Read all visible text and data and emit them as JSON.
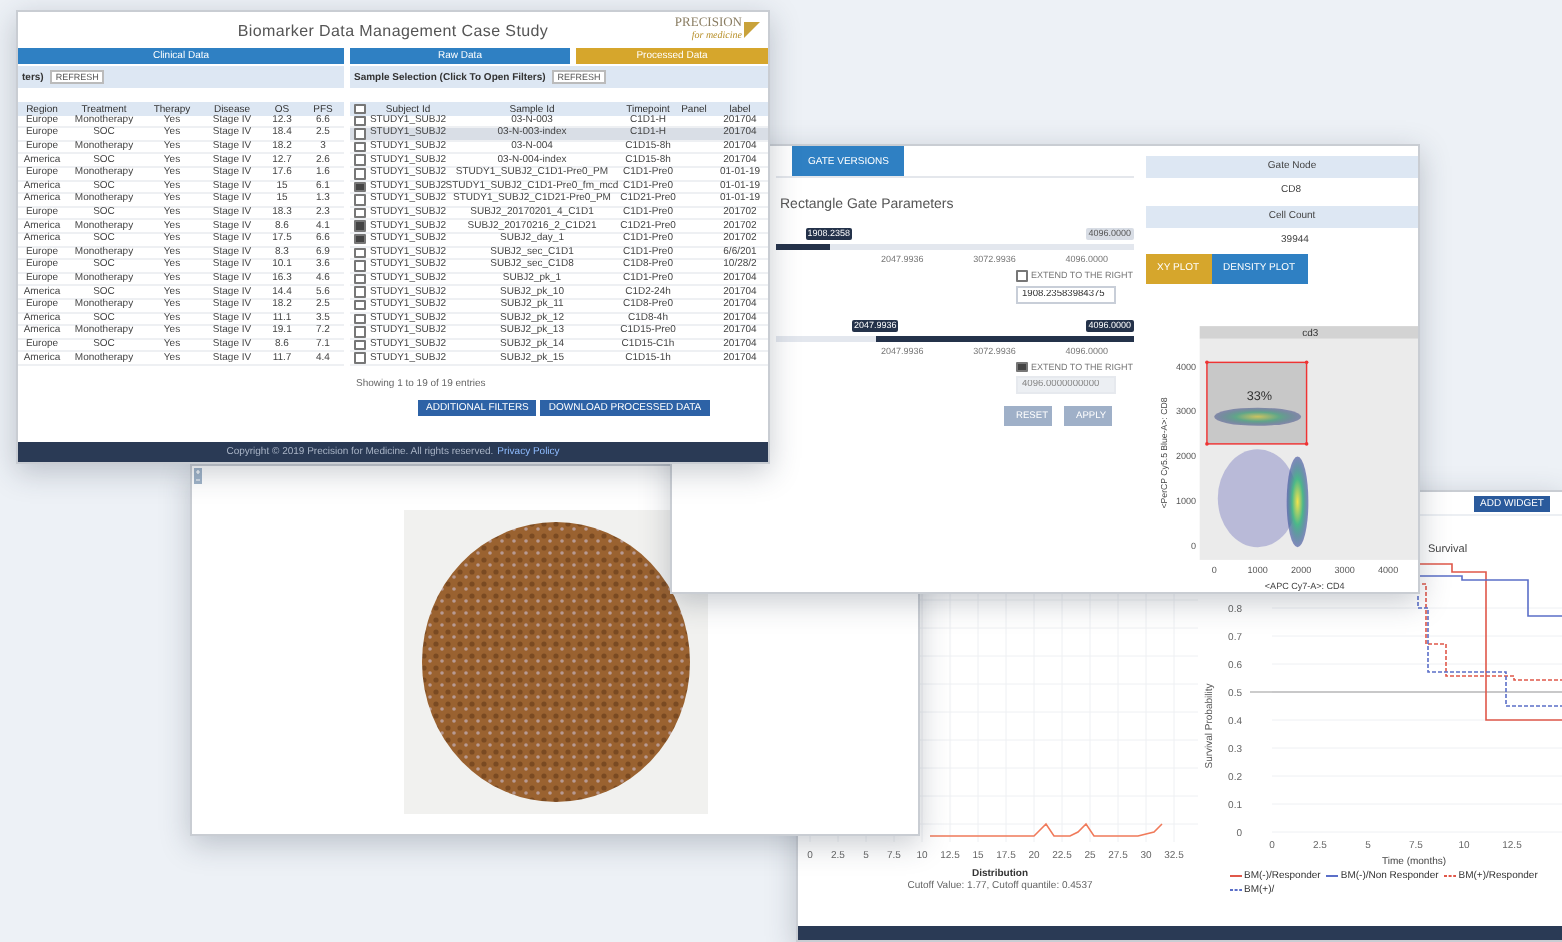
{
  "table_window": {
    "title": "Biomarker Data Management Case Study",
    "logo": {
      "name": "PRECISION",
      "tagline": "for medicine"
    },
    "tabs": [
      {
        "label": "Clinical Data",
        "selected": false
      },
      {
        "label": "Raw Data",
        "selected": false
      },
      {
        "label": "Processed Data",
        "selected": true
      }
    ],
    "filters": [
      {
        "label": "ters)",
        "button": "REFRESH"
      },
      {
        "label": "Sample Selection (Click To Open Filters)",
        "button": "REFRESH"
      }
    ],
    "clinical_table": {
      "columns": [
        "Region",
        "Treatment",
        "Therapy",
        "Disease",
        "OS",
        "PFS"
      ],
      "rows": [
        [
          "Europe",
          "Monotherapy",
          "Yes",
          "Stage IV",
          "12.3",
          "6.6"
        ],
        [
          "Europe",
          "SOC",
          "Yes",
          "Stage IV",
          "18.4",
          "2.5"
        ],
        [
          "Europe",
          "Monotherapy",
          "Yes",
          "Stage IV",
          "18.2",
          "3"
        ],
        [
          "America",
          "SOC",
          "Yes",
          "Stage IV",
          "12.7",
          "2.6"
        ],
        [
          "Europe",
          "Monotherapy",
          "Yes",
          "Stage IV",
          "17.6",
          "1.6"
        ],
        [
          "America",
          "SOC",
          "Yes",
          "Stage IV",
          "15",
          "6.1"
        ],
        [
          "America",
          "Monotherapy",
          "Yes",
          "Stage IV",
          "15",
          "1.3"
        ],
        [
          "Europe",
          "SOC",
          "Yes",
          "Stage IV",
          "18.3",
          "2.3"
        ],
        [
          "America",
          "Monotherapy",
          "Yes",
          "Stage IV",
          "8.6",
          "4.1"
        ],
        [
          "America",
          "SOC",
          "Yes",
          "Stage IV",
          "17.5",
          "6.6"
        ],
        [
          "Europe",
          "Monotherapy",
          "Yes",
          "Stage IV",
          "8.3",
          "6.9"
        ],
        [
          "Europe",
          "SOC",
          "Yes",
          "Stage IV",
          "10.1",
          "3.6"
        ],
        [
          "Europe",
          "Monotherapy",
          "Yes",
          "Stage IV",
          "16.3",
          "4.6"
        ],
        [
          "America",
          "SOC",
          "Yes",
          "Stage IV",
          "14.4",
          "5.6"
        ],
        [
          "Europe",
          "Monotherapy",
          "Yes",
          "Stage IV",
          "18.2",
          "2.5"
        ],
        [
          "America",
          "SOC",
          "Yes",
          "Stage IV",
          "11.1",
          "3.5"
        ],
        [
          "America",
          "Monotherapy",
          "Yes",
          "Stage IV",
          "19.1",
          "7.2"
        ],
        [
          "Europe",
          "SOC",
          "Yes",
          "Stage IV",
          "8.6",
          "7.1"
        ],
        [
          "America",
          "Monotherapy",
          "Yes",
          "Stage IV",
          "11.7",
          "4.4"
        ]
      ]
    },
    "sample_table": {
      "header_checked": false,
      "columns": [
        "Subject Id",
        "Sample Id",
        "Timepoint",
        "Panel",
        "label"
      ],
      "rows": [
        {
          "checked": false,
          "selected": false,
          "cells": [
            "STUDY1_SUBJ2",
            "03-N-003",
            "C1D1-H",
            "",
            "201704"
          ]
        },
        {
          "checked": false,
          "selected": true,
          "cells": [
            "STUDY1_SUBJ2",
            "03-N-003-index",
            "C1D1-H",
            "",
            "201704"
          ]
        },
        {
          "checked": false,
          "selected": false,
          "cells": [
            "STUDY1_SUBJ2",
            "03-N-004",
            "C1D15-8h",
            "",
            "201704"
          ]
        },
        {
          "checked": false,
          "selected": false,
          "cells": [
            "STUDY1_SUBJ2",
            "03-N-004-index",
            "C1D15-8h",
            "",
            "201704"
          ]
        },
        {
          "checked": false,
          "selected": false,
          "cells": [
            "STUDY1_SUBJ2",
            "STUDY1_SUBJ2_C1D1-Pre0_PM",
            "C1D1-Pre0",
            "",
            "01-01-19"
          ]
        },
        {
          "checked": true,
          "selected": false,
          "cells": [
            "STUDY1_SUBJ2",
            "STUDY1_SUBJ2_C1D1-Pre0_fm_mcd",
            "C1D1-Pre0",
            "",
            "01-01-19"
          ]
        },
        {
          "checked": false,
          "selected": false,
          "cells": [
            "STUDY1_SUBJ2",
            "STUDY1_SUBJ2_C1D21-Pre0_PM",
            "C1D21-Pre0",
            "",
            "01-01-19"
          ]
        },
        {
          "checked": false,
          "selected": false,
          "cells": [
            "STUDY1_SUBJ2",
            "SUBJ2_20170201_4_C1D1",
            "C1D1-Pre0",
            "",
            "201702"
          ]
        },
        {
          "checked": true,
          "selected": false,
          "cells": [
            "STUDY1_SUBJ2",
            "SUBJ2_20170216_2_C1D21",
            "C1D21-Pre0",
            "",
            "201702"
          ]
        },
        {
          "checked": true,
          "selected": false,
          "cells": [
            "STUDY1_SUBJ2",
            "SUBJ2_day_1",
            "C1D1-Pre0",
            "",
            "201702"
          ]
        },
        {
          "checked": false,
          "selected": false,
          "cells": [
            "STUDY1_SUBJ2",
            "SUBJ2_sec_C1D1",
            "C1D1-Pre0",
            "",
            "6/6/201"
          ]
        },
        {
          "checked": false,
          "selected": false,
          "cells": [
            "STUDY1_SUBJ2",
            "SUBJ2_sec_C1D8",
            "C1D8-Pre0",
            "",
            "10/28/2"
          ]
        },
        {
          "checked": false,
          "selected": false,
          "cells": [
            "STUDY1_SUBJ2",
            "SUBJ2_pk_1",
            "C1D1-Pre0",
            "",
            "201704"
          ]
        },
        {
          "checked": false,
          "selected": false,
          "cells": [
            "STUDY1_SUBJ2",
            "SUBJ2_pk_10",
            "C1D2-24h",
            "",
            "201704"
          ]
        },
        {
          "checked": false,
          "selected": false,
          "cells": [
            "STUDY1_SUBJ2",
            "SUBJ2_pk_11",
            "C1D8-Pre0",
            "",
            "201704"
          ]
        },
        {
          "checked": false,
          "selected": false,
          "cells": [
            "STUDY1_SUBJ2",
            "SUBJ2_pk_12",
            "C1D8-4h",
            "",
            "201704"
          ]
        },
        {
          "checked": false,
          "selected": false,
          "cells": [
            "STUDY1_SUBJ2",
            "SUBJ2_pk_13",
            "C1D15-Pre0",
            "",
            "201704"
          ]
        },
        {
          "checked": false,
          "selected": false,
          "cells": [
            "STUDY1_SUBJ2",
            "SUBJ2_pk_14",
            "C1D15-C1h",
            "",
            "201704"
          ]
        },
        {
          "checked": false,
          "selected": false,
          "cells": [
            "STUDY1_SUBJ2",
            "SUBJ2_pk_15",
            "C1D15-1h",
            "",
            "201704"
          ]
        }
      ]
    },
    "entries_info": "Showing 1 to 19 of 19 entries",
    "buttons": [
      "ADDITIONAL FILTERS",
      "DOWNLOAD PROCESSED DATA"
    ],
    "footer": {
      "text": "Copyright © 2019 Precision for Medicine. All rights reserved.",
      "link": "Privacy Policy"
    }
  },
  "gate_window": {
    "tabs": [
      {
        "label": "GATE VERSIONS",
        "selected": true
      }
    ],
    "heading": "Rectangle Gate Parameters",
    "sliders": [
      {
        "kind": "lower",
        "level": 0.15,
        "thumb_label": "1908.2358",
        "max_label": "4096.0000",
        "ticks": [
          "2047.9936",
          "3072.9936",
          "4096.0000"
        ],
        "extend": {
          "label": "EXTEND TO THE RIGHT",
          "checked": false
        },
        "field": {
          "value": "1908.23583984375",
          "disabled": false
        }
      },
      {
        "kind": "upper",
        "level": 0.72,
        "thumb_label": "2047.9936",
        "max_label": "4096.0000",
        "ticks": [
          "2047.9936",
          "3072.9936",
          "4096.0000"
        ],
        "extend": {
          "label": "EXTEND TO THE RIGHT",
          "checked": true
        },
        "field": {
          "placeholder": "4096.0000000000",
          "disabled": true
        }
      }
    ],
    "buttons": [
      {
        "label": "RESET",
        "disabled": true
      },
      {
        "label": "APPLY",
        "disabled": true
      }
    ],
    "info": [
      {
        "header": "Gate Node",
        "value": "CD8"
      },
      {
        "header": "Cell Count",
        "value": "39944"
      }
    ],
    "plot_buttons": [
      {
        "label": "XY PLOT",
        "selected": true
      },
      {
        "label": "DENSITY PLOT",
        "selected": false
      }
    ],
    "plot": {
      "strip": "cd3",
      "gate_label": "33%",
      "yticks": [
        "4000",
        "3000",
        "2000",
        "1000",
        "0"
      ],
      "xticks": [
        "0",
        "1000",
        "2000",
        "3000",
        "4000"
      ],
      "xlabel": "<APC Cy7-A>: CD4",
      "ylabel": "<PerCP Cy5.5 Blue-A>: CD8"
    }
  },
  "chart_window": {
    "button": "ADD WIDGET",
    "distribution": {
      "xticks": [
        "0",
        "2.5",
        "5",
        "7.5",
        "10",
        "12.5",
        "15",
        "17.5",
        "20",
        "22.5",
        "25",
        "27.5",
        "30",
        "32.5"
      ],
      "legend": "Distribution",
      "note": "Cutoff Value: 1.77, Cutoff quantile: 0.4537"
    },
    "survival": {
      "title": "Survival",
      "ylabel": "Survival Probability",
      "yticks": [
        "0.8",
        "0.7",
        "0.6",
        "0.5",
        "0.4",
        "0.3",
        "0.2",
        "0.1",
        "0"
      ],
      "xticks": [
        "0",
        "2.5",
        "5",
        "7.5",
        "10",
        "12.5"
      ],
      "xlabel": "Time (months)",
      "legend": [
        {
          "label": "BM(-)/Responder",
          "color": "#e0584a",
          "dashed": false
        },
        {
          "label": "BM(-)/Non Responder",
          "color": "#5b6fc8",
          "dashed": false
        },
        {
          "label": "BM(+)/Responder",
          "color": "#e0584a",
          "dashed": true
        },
        {
          "label": "BM(+)/",
          "color": "#5b6fc8",
          "dashed": true
        }
      ]
    }
  }
}
